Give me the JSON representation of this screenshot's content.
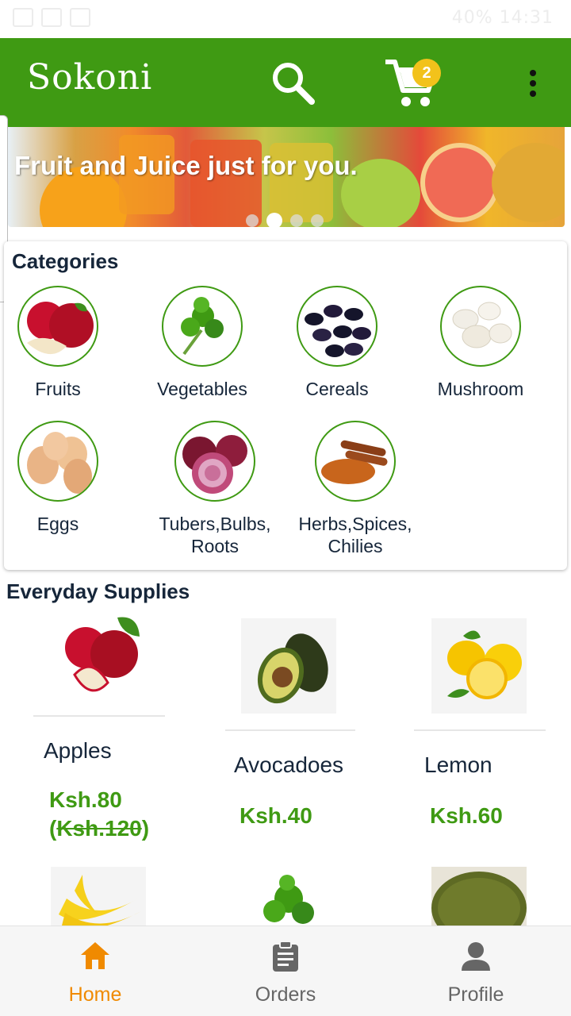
{
  "status_bar": {
    "right_text": "40%  14:31"
  },
  "app_bar": {
    "title": "Sokoni",
    "search_icon": "search-icon",
    "cart_icon": "cart-icon",
    "cart_count": "2",
    "menu_icon": "more-vert-icon",
    "color": "#3f9a13"
  },
  "banner": {
    "text": "Fruit and Juice just for you.",
    "slide_count": 4,
    "active_slide": 2
  },
  "categories": {
    "title": "Categories",
    "items": [
      {
        "label": "Fruits",
        "icon": "apple-icon"
      },
      {
        "label": "Vegetables",
        "icon": "parsley-icon"
      },
      {
        "label": "Cereals",
        "icon": "beans-icon"
      },
      {
        "label": "Mushroom",
        "icon": "mushroom-icon"
      },
      {
        "label": "Eggs",
        "icon": "eggs-icon"
      },
      {
        "label": "Tubers,Bulbs,\nRoots",
        "label_line1": "Tubers,Bulbs,",
        "label_line2": "Roots",
        "icon": "onion-icon"
      },
      {
        "label": "Herbs,Spices,\nChilies",
        "label_line1": "Herbs,Spices,",
        "label_line2": "Chilies",
        "icon": "cinnamon-icon"
      }
    ]
  },
  "everyday": {
    "title": "Everyday Supplies",
    "products": [
      {
        "name": "Apples",
        "price": "Ksh.80",
        "old_price": "Ksh.120",
        "icon": "apples-image"
      },
      {
        "name": "Avocadoes",
        "price": "Ksh.40",
        "icon": "avocado-image"
      },
      {
        "name": "Lemon",
        "price": "Ksh.60",
        "icon": "lemon-image"
      },
      {
        "icon": "banana-image"
      },
      {
        "icon": "coriander-image"
      },
      {
        "icon": "green-grams-image"
      }
    ]
  },
  "bottom_nav": {
    "items": [
      {
        "label": "Home",
        "icon": "home-icon",
        "active": true
      },
      {
        "label": "Orders",
        "icon": "clipboard-icon",
        "active": false
      },
      {
        "label": "Profile",
        "icon": "person-icon",
        "active": false
      }
    ],
    "active_color": "#f08a00"
  }
}
